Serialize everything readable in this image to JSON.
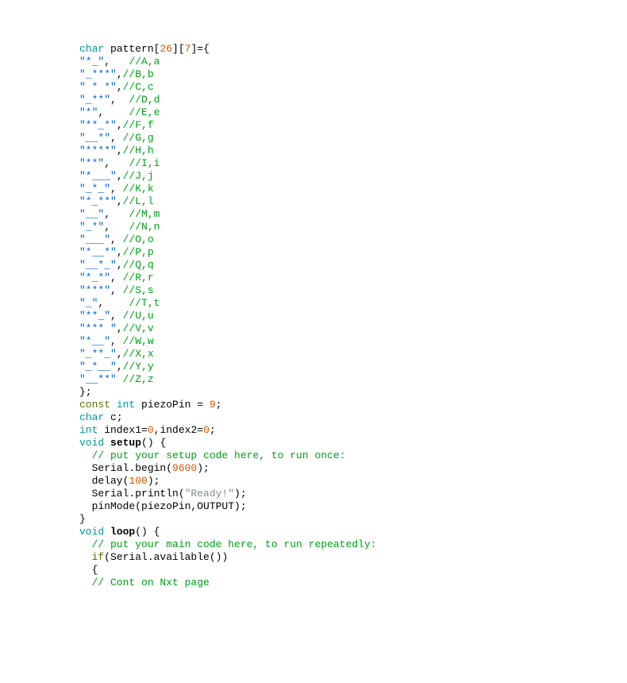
{
  "tokens": {
    "char": "char",
    "constk": "const",
    "intk": "int",
    "voidk": "void",
    "ifk": "if",
    "num26": "26",
    "num7": "7",
    "num9": "9",
    "num0a": "0",
    "num0b": "0",
    "num9600": "9600",
    "num100": "100"
  },
  "decl": {
    "patternLhs": " pattern[",
    "mid": "][",
    "end": "]={",
    "closer": "};",
    "piezo": " piezoPin = ",
    "piezoEnd": ";",
    "cDecl": " c;",
    "idx1": " index1=",
    "idxComma": ",index2=",
    "idxEnd": ";"
  },
  "patterns": [
    {
      "str": "\"*_\"",
      "pad": ",   ",
      "cmt": "//A,a"
    },
    {
      "str": "\"_***\"",
      "pad": ",",
      "cmt": "//B,b"
    },
    {
      "str": "\" * *\"",
      "pad": ",",
      "cmt": "//C,c"
    },
    {
      "str": "\"_**\"",
      "pad": ",  ",
      "cmt": "//D,d"
    },
    {
      "str": "\"*\"",
      "pad": ",    ",
      "cmt": "//E,e"
    },
    {
      "str": "\"**_*\"",
      "pad": ",",
      "cmt": "//F,f"
    },
    {
      "str": "\"__*\"",
      "pad": ", ",
      "cmt": "//G,g"
    },
    {
      "str": "\"****\"",
      "pad": ",",
      "cmt": "//H,h"
    },
    {
      "str": "\"**\"",
      "pad": ",   ",
      "cmt": "//I,i"
    },
    {
      "str": "\"*___\"",
      "pad": ",",
      "cmt": "//J,j"
    },
    {
      "str": "\"_*_\"",
      "pad": ", ",
      "cmt": "//K,k"
    },
    {
      "str": "\"*_**\"",
      "pad": ",",
      "cmt": "//L,l"
    },
    {
      "str": "\"__\"",
      "pad": ",   ",
      "cmt": "//M,m"
    },
    {
      "str": "\"_*\"",
      "pad": ",   ",
      "cmt": "//N,n"
    },
    {
      "str": "\"___\"",
      "pad": ", ",
      "cmt": "//O,o"
    },
    {
      "str": "\"*__*\"",
      "pad": ",",
      "cmt": "//P,p"
    },
    {
      "str": "\"__*_\"",
      "pad": ",",
      "cmt": "//Q,q"
    },
    {
      "str": "\"*_*\"",
      "pad": ", ",
      "cmt": "//R,r"
    },
    {
      "str": "\"***\"",
      "pad": ", ",
      "cmt": "//S,s"
    },
    {
      "str": "\"_\"",
      "pad": ",    ",
      "cmt": "//T,t"
    },
    {
      "str": "\"**_\"",
      "pad": ", ",
      "cmt": "//U,u"
    },
    {
      "str": "\"*** \"",
      "pad": ",",
      "cmt": "//V,v"
    },
    {
      "str": "\"*__\"",
      "pad": ", ",
      "cmt": "//W,w"
    },
    {
      "str": "\"_**_\"",
      "pad": ",",
      "cmt": "//X,x"
    },
    {
      "str": "\"_*__\"",
      "pad": ",",
      "cmt": "//Y,y"
    },
    {
      "str": "\"__**\"",
      "pad": " ",
      "cmt": "//Z,z"
    }
  ],
  "setup": {
    "sig": " setup() {",
    "cmt": "  // put your setup code here, to run once:",
    "l1a": "  Serial.begin(",
    "l1b": ");",
    "l2a": "  delay(",
    "l2b": ");",
    "l3a": "  Serial.println(",
    "l3str": "\"Ready!\"",
    "l3b": ");",
    "l4": "  pinMode(piezoPin,OUTPUT);",
    "close": "}"
  },
  "loop": {
    "sig": " loop() {",
    "cmt": "  // put your main code here, to run repeatedly:",
    "ifLineA": "  ",
    "ifLineB": "(Serial.available())",
    "brace": "  {",
    "cont": "  // Cont on Nxt page"
  }
}
